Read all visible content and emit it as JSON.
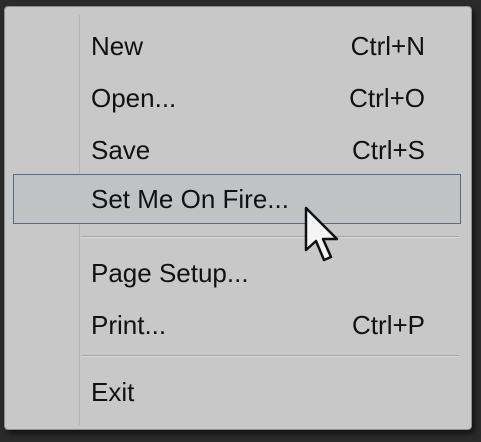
{
  "menu": {
    "items": [
      {
        "label": "New",
        "shortcut": "Ctrl+N"
      },
      {
        "label": "Open...",
        "shortcut": "Ctrl+O"
      },
      {
        "label": "Save",
        "shortcut": "Ctrl+S"
      },
      {
        "label": "Set Me On Fire...",
        "shortcut": ""
      },
      {
        "label": "Page Setup...",
        "shortcut": ""
      },
      {
        "label": "Print...",
        "shortcut": "Ctrl+P"
      },
      {
        "label": "Exit",
        "shortcut": ""
      }
    ],
    "highlighted_item": "Set Me On Fire..."
  },
  "cursor": {
    "icon": "arrow-pointer-icon"
  },
  "colors": {
    "menu_background": "#c8c8c8",
    "highlight_border": "#5e6b78",
    "page_background": "#2b2b2b"
  }
}
